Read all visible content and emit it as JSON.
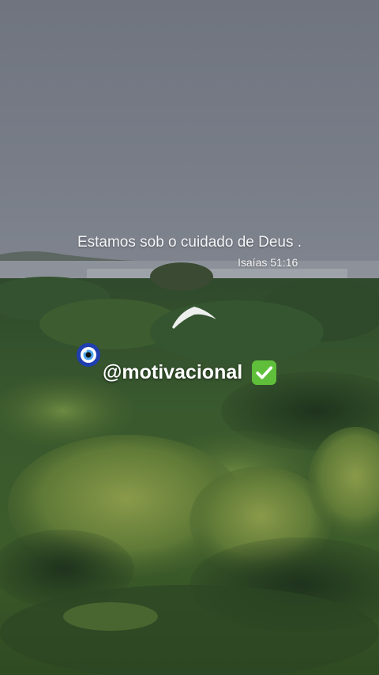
{
  "story": {
    "quote": "Estamos sob o cuidado de Deus .",
    "reference": "Isaías 51:16",
    "handle": "@motivacional"
  },
  "icons": {
    "nazar": "nazar-amulet-icon",
    "check": "check-mark-button-icon"
  },
  "colors": {
    "sky": "#747a86",
    "foliage": "#3f5e2c",
    "text": "#f4f5f6",
    "check_green": "#5fbf3a"
  }
}
